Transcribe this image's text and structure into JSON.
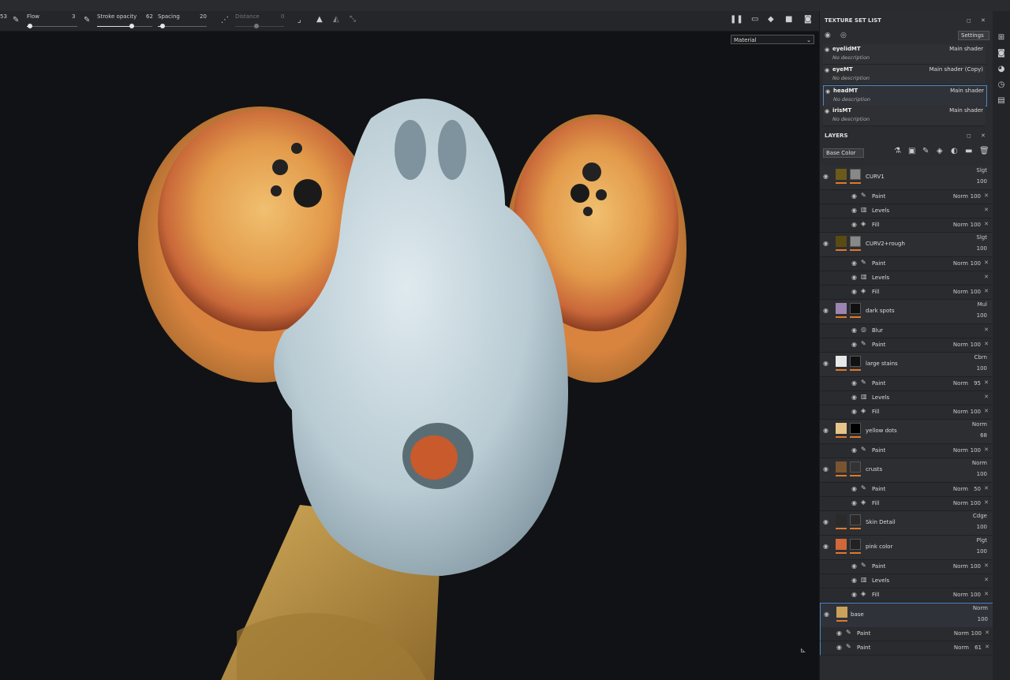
{
  "toolbar": {
    "left_value": "53",
    "flow_label": "Flow",
    "flow_value": "3",
    "stroke_opacity_label": "Stroke opacity",
    "stroke_opacity_value": "62",
    "spacing_label": "Spacing",
    "spacing_value": "20",
    "distance_label": "Distance",
    "distance_value": "0"
  },
  "viewport": {
    "material_select": "Material"
  },
  "texture_set_list": {
    "title": "TEXTURE SET LIST",
    "settings_label": "Settings",
    "items": [
      {
        "name": "eyelidMT",
        "shader": "Main shader",
        "desc": "No description"
      },
      {
        "name": "eyeMT",
        "shader": "Main shader (Copy)",
        "desc": "No description"
      },
      {
        "name": "headMT",
        "shader": "Main shader",
        "desc": "No description"
      },
      {
        "name": "irisMT",
        "shader": "Main shader",
        "desc": "No description"
      }
    ]
  },
  "layers": {
    "title": "LAYERS",
    "channel_select": "Base Color",
    "groups": [
      {
        "name": "CURV1",
        "blend": "Slgt",
        "opacity": "100",
        "subs": [
          {
            "name": "Paint",
            "blend": "Norm",
            "op": "100"
          },
          {
            "name": "Levels",
            "blend": "",
            "op": ""
          },
          {
            "name": "Fill",
            "blend": "Norm",
            "op": "100"
          }
        ]
      },
      {
        "name": "CURV2+rough",
        "blend": "Slgt",
        "opacity": "100",
        "subs": [
          {
            "name": "Paint",
            "blend": "Norm",
            "op": "100"
          },
          {
            "name": "Levels",
            "blend": "",
            "op": ""
          },
          {
            "name": "Fill",
            "blend": "Norm",
            "op": "100"
          }
        ]
      },
      {
        "name": "dark spots",
        "blend": "Mul",
        "opacity": "100",
        "subs": [
          {
            "name": "Blur",
            "blend": "",
            "op": ""
          },
          {
            "name": "Paint",
            "blend": "Norm",
            "op": "100"
          }
        ]
      },
      {
        "name": "large stains",
        "blend": "Cbrn",
        "opacity": "100",
        "subs": [
          {
            "name": "Paint",
            "blend": "Norm",
            "op": "95"
          },
          {
            "name": "Levels",
            "blend": "",
            "op": ""
          },
          {
            "name": "Fill",
            "blend": "Norm",
            "op": "100"
          }
        ]
      },
      {
        "name": "yellow dots",
        "blend": "Norm",
        "opacity": "68",
        "subs": [
          {
            "name": "Paint",
            "blend": "Norm",
            "op": "100"
          }
        ]
      },
      {
        "name": "crusts",
        "blend": "Norm",
        "opacity": "100",
        "subs": [
          {
            "name": "Paint",
            "blend": "Norm",
            "op": "50"
          },
          {
            "name": "Fill",
            "blend": "Norm",
            "op": "100"
          }
        ]
      },
      {
        "name": "Skin Detail",
        "blend": "Cdge",
        "opacity": "100",
        "subs": []
      },
      {
        "name": "pink color",
        "blend": "Plgt",
        "opacity": "100",
        "subs": [
          {
            "name": "Paint",
            "blend": "Norm",
            "op": "100"
          },
          {
            "name": "Levels",
            "blend": "",
            "op": ""
          },
          {
            "name": "Fill",
            "blend": "Norm",
            "op": "100"
          }
        ]
      },
      {
        "name": "base",
        "blend": "Norm",
        "opacity": "100",
        "subs": [
          {
            "name": "Paint",
            "blend": "Norm",
            "op": "100"
          },
          {
            "name": "Paint",
            "blend": "Norm",
            "op": "61"
          }
        ]
      }
    ]
  }
}
